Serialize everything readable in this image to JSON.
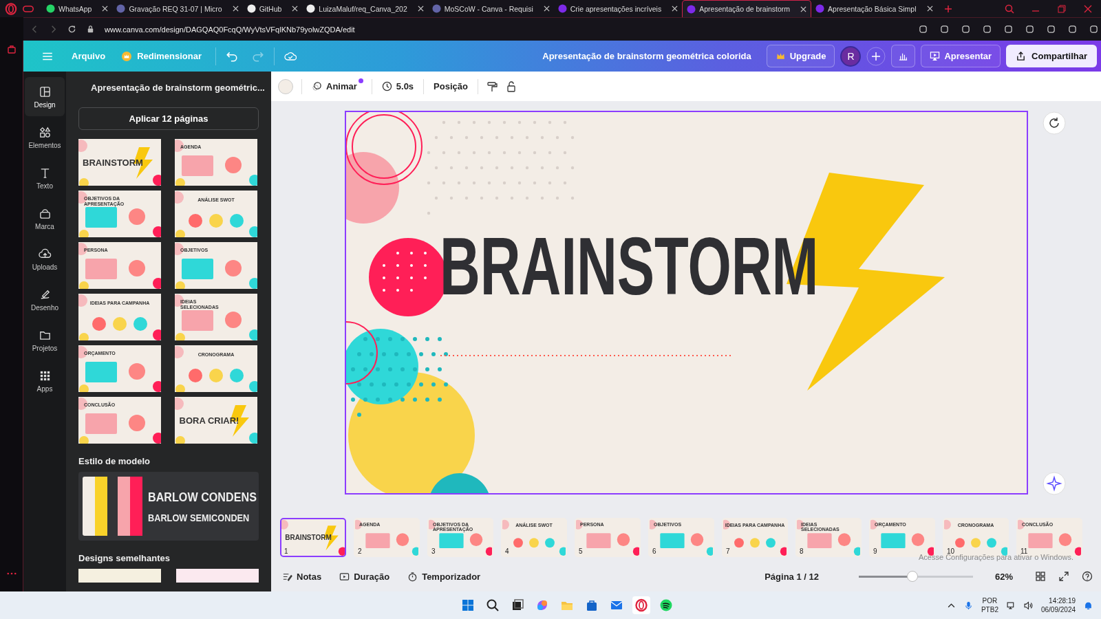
{
  "browser": {
    "tabs": [
      {
        "title": "WhatsApp",
        "selected": false
      },
      {
        "title": "Gravação REQ 31-07 | Micro",
        "selected": false
      },
      {
        "title": "GitHub",
        "selected": false
      },
      {
        "title": "LuizaMaluf/req_Canva_202",
        "selected": false
      },
      {
        "title": "MoSCoW - Canva - Requisi",
        "selected": false
      },
      {
        "title": "Crie apresentações incríveis",
        "selected": false
      },
      {
        "title": "Apresentação de brainstorm",
        "selected": true
      },
      {
        "title": "Apresentação Básica Simpl",
        "selected": false
      }
    ],
    "url": "www.canva.com/design/DAGQAQ0FcqQ/WyVtsVFqlKNb79yolwZQDA/edit"
  },
  "header": {
    "file_menu": "Arquivo",
    "resize": "Redimensionar",
    "design_title": "Apresentação de brainstorm geométrica colorida",
    "upgrade": "Upgrade",
    "avatar": "R",
    "present": "Apresentar",
    "share": "Compartilhar"
  },
  "rail": [
    {
      "label": "Design",
      "kind": "design",
      "selected": true
    },
    {
      "label": "Elementos",
      "kind": "elements",
      "selected": false
    },
    {
      "label": "Texto",
      "kind": "text",
      "selected": false
    },
    {
      "label": "Marca",
      "kind": "brand",
      "selected": false
    },
    {
      "label": "Uploads",
      "kind": "upload",
      "selected": false
    },
    {
      "label": "Desenho",
      "kind": "draw",
      "selected": false
    },
    {
      "label": "Projetos",
      "kind": "folder",
      "selected": false
    },
    {
      "label": "Apps",
      "kind": "apps",
      "selected": false
    }
  ],
  "panel": {
    "title": "Apresentação de brainstorm geométric...",
    "apply_button": "Aplicar 12 páginas",
    "thumbnails": [
      {
        "title": "BRAINSTORM",
        "kind": "cover"
      },
      {
        "title": "AGENDA",
        "kind": "section"
      },
      {
        "title": "OBJETIVOS DA APRESENTAÇÃO",
        "kind": "section"
      },
      {
        "title": "ANÁLISE SWOT",
        "kind": "center"
      },
      {
        "title": "PERSONA",
        "kind": "section"
      },
      {
        "title": "OBJETIVOS",
        "kind": "section"
      },
      {
        "title": "IDEIAS PARA CAMPANHA",
        "kind": "center"
      },
      {
        "title": "IDEIAS SELECIONADAS",
        "kind": "section"
      },
      {
        "title": "ORÇAMENTO",
        "kind": "section"
      },
      {
        "title": "CRONOGRAMA",
        "kind": "center"
      },
      {
        "title": "CONCLUSÃO",
        "kind": "section"
      },
      {
        "title": "BORA CRIAR!",
        "kind": "cover"
      }
    ],
    "style_heading": "Estilo de modelo",
    "fonts": [
      "BARLOW CONDENS",
      "BARLOW SEMICONDEN"
    ],
    "similar_heading": "Designs semelhantes"
  },
  "toolbar": {
    "animate": "Animar",
    "duration": "5.0s",
    "position": "Posição"
  },
  "slide": {
    "title": "BRAINSTORM"
  },
  "filmstrip": [
    {
      "number": "1",
      "title": "BRAINSTORM",
      "kind": "cover",
      "selected": true
    },
    {
      "number": "2",
      "title": "AGENDA",
      "kind": "section",
      "selected": false
    },
    {
      "number": "3",
      "title": "OBJETIVOS DA APRESENTAÇÃO",
      "kind": "section",
      "selected": false
    },
    {
      "number": "4",
      "title": "ANÁLISE SWOT",
      "kind": "center",
      "selected": false
    },
    {
      "number": "5",
      "title": "PERSONA",
      "kind": "section",
      "selected": false
    },
    {
      "number": "6",
      "title": "OBJETIVOS",
      "kind": "section",
      "selected": false
    },
    {
      "number": "7",
      "title": "IDEIAS PARA CAMPANHA",
      "kind": "center",
      "selected": false
    },
    {
      "number": "8",
      "title": "IDEIAS SELECIONADAS",
      "kind": "section",
      "selected": false
    },
    {
      "number": "9",
      "title": "ORÇAMENTO",
      "kind": "section",
      "selected": false
    },
    {
      "number": "10",
      "title": "CRONOGRAMA",
      "kind": "center",
      "selected": false
    },
    {
      "number": "11",
      "title": "CONCLUSÃO",
      "kind": "section",
      "selected": false
    }
  ],
  "bottom_bar": {
    "notes": "Notas",
    "duration": "Duração",
    "timer": "Temporizador",
    "page": "Página 1 / 12",
    "zoom_slider": {
      "level": 0.47
    },
    "zoom": "62%"
  },
  "activation_notice": "Acesse Configurações para ativar o Windows.",
  "taskbar": {
    "language": "POR",
    "layout": "PTB2",
    "time": "14:28:19",
    "date": "06/09/2024"
  }
}
